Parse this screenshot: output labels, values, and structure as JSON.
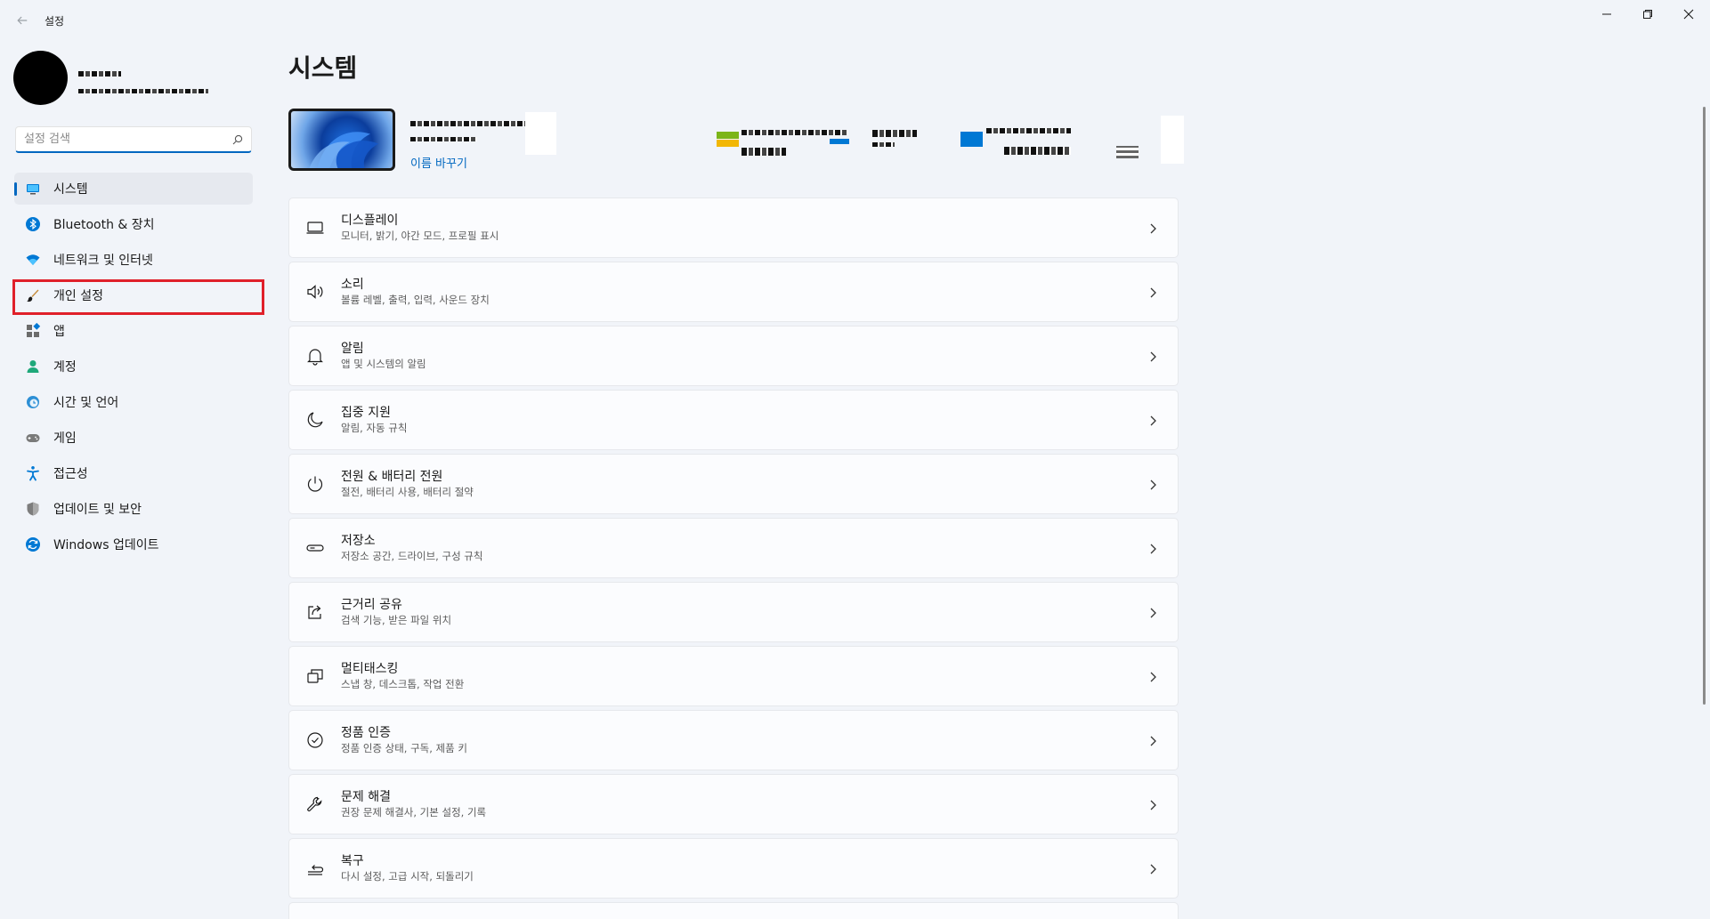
{
  "window": {
    "title": "설정"
  },
  "search": {
    "placeholder": "설정 검색"
  },
  "sidebar": {
    "items": [
      {
        "label": "시스템",
        "icon": "system-icon",
        "active": true
      },
      {
        "label": "Bluetooth & 장치",
        "icon": "bluetooth-icon"
      },
      {
        "label": "네트워크 및 인터넷",
        "icon": "network-icon"
      },
      {
        "label": "개인 설정",
        "icon": "personalization-brush-icon"
      },
      {
        "label": "앱",
        "icon": "apps-icon"
      },
      {
        "label": "계정",
        "icon": "account-icon"
      },
      {
        "label": "시간 및 언어",
        "icon": "time-language-icon"
      },
      {
        "label": "게임",
        "icon": "gamepad-icon"
      },
      {
        "label": "접근성",
        "icon": "accessibility-icon"
      },
      {
        "label": "업데이트 및 보안",
        "icon": "shield-icon"
      },
      {
        "label": "Windows 업데이트",
        "icon": "windows-update-icon"
      }
    ]
  },
  "main": {
    "title": "시스템",
    "rename_label": "이름 바꾸기",
    "cards": [
      {
        "title": "디스플레이",
        "subtitle": "모니터, 밝기, 야간 모드, 프로필 표시",
        "icon": "display-icon"
      },
      {
        "title": "소리",
        "subtitle": "볼륨 레벨, 출력, 입력, 사운드 장치",
        "icon": "speaker-icon"
      },
      {
        "title": "알림",
        "subtitle": "앱 및 시스템의 알림",
        "icon": "bell-icon"
      },
      {
        "title": "집중 지원",
        "subtitle": "알림, 자동 규칙",
        "icon": "moon-icon"
      },
      {
        "title": "전원 & 배터리 전원",
        "subtitle": "절전, 배터리 사용, 배터리 절약",
        "icon": "power-icon"
      },
      {
        "title": "저장소",
        "subtitle": "저장소 공간, 드라이브, 구성 규칙",
        "icon": "storage-icon"
      },
      {
        "title": "근거리 공유",
        "subtitle": "검색 기능, 받은 파일 위치",
        "icon": "share-icon"
      },
      {
        "title": "멀티태스킹",
        "subtitle": "스냅 창, 데스크톱, 작업 전환",
        "icon": "multitasking-icon"
      },
      {
        "title": "정품 인증",
        "subtitle": "정품 인증 상태, 구독, 제품 키",
        "icon": "check-circle-icon"
      },
      {
        "title": "문제 해결",
        "subtitle": "권장 문제 해결사, 기본 설정, 기록",
        "icon": "wrench-icon"
      },
      {
        "title": "복구",
        "subtitle": "다시 설정, 고급 시작, 되돌리기",
        "icon": "recovery-icon"
      }
    ]
  },
  "colors": {
    "accent": "#0067c0",
    "highlight": "#e0202a",
    "background": "#f1f4f9",
    "card": "#fbfcfe"
  }
}
